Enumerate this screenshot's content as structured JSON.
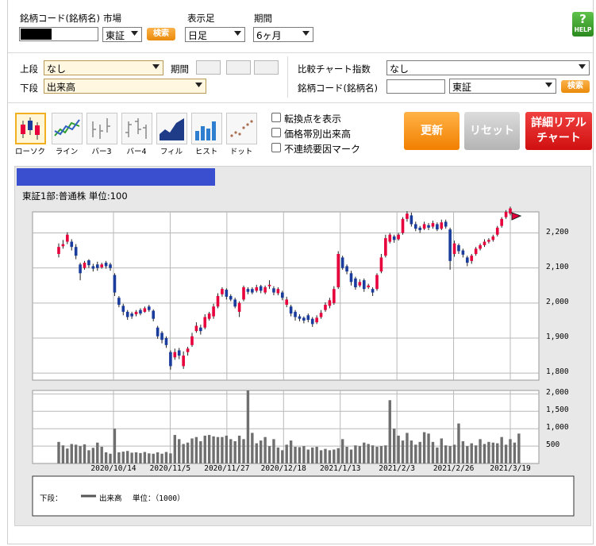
{
  "search_form": {
    "code_label": "銘柄コード(銘柄名)",
    "market_label": "市場",
    "market_value": "東証",
    "search_button": "検索",
    "foot_label": "表示足",
    "foot_value": "日足",
    "period_label": "期間",
    "period_value": "6ヶ月",
    "help_button": "HELP"
  },
  "indicators": {
    "upper_label": "上段",
    "upper_value": "なし",
    "period_label": "期間",
    "lower_label": "下段",
    "lower_value": "出来高",
    "compare_label": "比較チャート指数",
    "compare_value": "なし",
    "compare_code_label": "銘柄コード(銘柄名)",
    "compare_market_value": "東証",
    "compare_search_button": "検索"
  },
  "chart_types": [
    {
      "label": "ローソク",
      "icon": "candlestick-icon"
    },
    {
      "label": "ライン",
      "icon": "line-chart-icon"
    },
    {
      "label": "バー3",
      "icon": "bar3-icon"
    },
    {
      "label": "バー4",
      "icon": "bar4-icon"
    },
    {
      "label": "フィル",
      "icon": "fill-chart-icon"
    },
    {
      "label": "ヒスト",
      "icon": "histogram-icon"
    },
    {
      "label": "ドット",
      "icon": "dot-chart-icon"
    }
  ],
  "options": {
    "turning_point": "転換点を表示",
    "volume_by_price": "価格帯別出来高",
    "discontinuity": "不連続要因マーク"
  },
  "actions": {
    "update": "更新",
    "reset": "リセット",
    "realtime_line1": "詳細リアル",
    "realtime_line2": "チャート"
  },
  "chart_header": "東証1部:普通株 単位:100",
  "legend": {
    "prefix": "下段：",
    "series": "出来高",
    "unit": "単位：（1000）"
  },
  "colors": {
    "up": "#e8003c",
    "down": "#1a3c9c",
    "volume": "#6f6f6f",
    "update_btn": "#f7931e",
    "reset_btn": "#c8c8c8",
    "realtime_btn": "#e02020"
  },
  "chart_data": {
    "type": "candlestick",
    "price_axis": {
      "ticks": [
        "2,200",
        "2,100",
        "2,000",
        "1,900",
        "1,800"
      ],
      "ylim": [
        1780,
        2260
      ]
    },
    "volume_axis": {
      "ticks": [
        "2,000",
        "1,500",
        "1,000",
        "500"
      ],
      "ylim": [
        0,
        2100
      ]
    },
    "x_labels": [
      "2020/10/14",
      "2020/11/5",
      "2020/11/27",
      "2020/12/18",
      "2021/1/13",
      "2021/2/3",
      "2021/2/26",
      "2021/3/19"
    ],
    "candles": [
      {
        "o": 2140.0,
        "c": 2160.0,
        "h": 2170.0,
        "l": 2130.0
      },
      {
        "o": 2162.0,
        "c": 2168.0,
        "h": 2180.0,
        "l": 2155.0
      },
      {
        "o": 2175.0,
        "c": 2195.0,
        "h": 2202.0,
        "l": 2168.0
      },
      {
        "o": 2175.0,
        "c": 2160.0,
        "h": 2182.0,
        "l": 2150.0
      },
      {
        "o": 2160.0,
        "c": 2135.0,
        "h": 2168.0,
        "l": 2125.0
      },
      {
        "o": 2110.0,
        "c": 2085.0,
        "h": 2115.0,
        "l": 2065.0
      },
      {
        "o": 2100.0,
        "c": 2115.0,
        "h": 2120.0,
        "l": 2095.0
      },
      {
        "o": 2122.0,
        "c": 2108.0,
        "h": 2125.0,
        "l": 2100.0
      },
      {
        "o": 2105.0,
        "c": 2098.0,
        "h": 2112.0,
        "l": 2090.0
      },
      {
        "o": 2110.0,
        "c": 2100.0,
        "h": 2118.0,
        "l": 2092.0
      },
      {
        "o": 2102.0,
        "c": 2110.0,
        "h": 2115.0,
        "l": 2098.0
      },
      {
        "o": 2115.0,
        "c": 2105.0,
        "h": 2120.0,
        "l": 2098.0
      },
      {
        "o": 2110.0,
        "c": 2100.0,
        "h": 2115.0,
        "l": 2092.0
      },
      {
        "o": 2080.0,
        "c": 2030.0,
        "h": 2085.0,
        "l": 2020.0
      },
      {
        "o": 2015.0,
        "c": 1995.0,
        "h": 2020.0,
        "l": 1988.0
      },
      {
        "o": 1992.0,
        "c": 1975.0,
        "h": 1998.0,
        "l": 1965.0
      },
      {
        "o": 1975.0,
        "c": 1960.0,
        "h": 1980.0,
        "l": 1952.0
      },
      {
        "o": 1970.0,
        "c": 1962.0,
        "h": 1975.0,
        "l": 1955.0
      },
      {
        "o": 1968.0,
        "c": 1975.0,
        "h": 1980.0,
        "l": 1962.0
      },
      {
        "o": 1980.0,
        "c": 1970.0,
        "h": 1985.0,
        "l": 1965.0
      },
      {
        "o": 1975.0,
        "c": 1985.0,
        "h": 1990.0,
        "l": 1972.0
      },
      {
        "o": 1990.0,
        "c": 1980.0,
        "h": 1995.0,
        "l": 1975.0
      },
      {
        "o": 1978.0,
        "c": 1955.0,
        "h": 1982.0,
        "l": 1948.0
      },
      {
        "o": 1930.0,
        "c": 1905.0,
        "h": 1935.0,
        "l": 1898.0
      },
      {
        "o": 1915.0,
        "c": 1895.0,
        "h": 1920.0,
        "l": 1885.0
      },
      {
        "o": 1900.0,
        "c": 1880.0,
        "h": 1905.0,
        "l": 1872.0
      },
      {
        "o": 1860.0,
        "c": 1820.0,
        "h": 1865.0,
        "l": 1810.0
      },
      {
        "o": 1845.0,
        "c": 1860.0,
        "h": 1870.0,
        "l": 1838.0
      },
      {
        "o": 1865.0,
        "c": 1850.0,
        "h": 1872.0,
        "l": 1840.0
      },
      {
        "o": 1820.0,
        "c": 1850.0,
        "h": 1862.0,
        "l": 1812.0
      },
      {
        "o": 1860.0,
        "c": 1870.0,
        "h": 1875.0,
        "l": 1850.0
      },
      {
        "o": 1880.0,
        "c": 1905.0,
        "h": 1915.0,
        "l": 1875.0
      },
      {
        "o": 1920.0,
        "c": 1935.0,
        "h": 1945.0,
        "l": 1915.0
      },
      {
        "o": 1930.0,
        "c": 1920.0,
        "h": 1938.0,
        "l": 1910.0
      },
      {
        "o": 1930.0,
        "c": 1960.0,
        "h": 1968.0,
        "l": 1925.0
      },
      {
        "o": 1955.0,
        "c": 1970.0,
        "h": 1975.0,
        "l": 1950.0
      },
      {
        "o": 1962.0,
        "c": 1990.0,
        "h": 1998.0,
        "l": 1955.0
      },
      {
        "o": 1990.0,
        "c": 2020.0,
        "h": 2028.0,
        "l": 1985.0
      },
      {
        "o": 2025.0,
        "c": 2040.0,
        "h": 2045.0,
        "l": 2018.0
      },
      {
        "o": 2038.0,
        "c": 2018.0,
        "h": 2042.0,
        "l": 2010.0
      },
      {
        "o": 2020.0,
        "c": 2010.0,
        "h": 2025.0,
        "l": 2005.0
      },
      {
        "o": 2010.0,
        "c": 1990.0,
        "h": 2015.0,
        "l": 1985.0
      },
      {
        "o": 1975.0,
        "c": 2000.0,
        "h": 2005.0,
        "l": 1960.0
      },
      {
        "o": 2010.0,
        "c": 2045.0,
        "h": 2050.0,
        "l": 2005.0
      },
      {
        "o": 2040.0,
        "c": 2032.0,
        "h": 2045.0,
        "l": 2025.0
      },
      {
        "o": 2040.0,
        "c": 2030.0,
        "h": 2045.0,
        "l": 2025.0
      },
      {
        "o": 2035.0,
        "c": 2045.0,
        "h": 2052.0,
        "l": 2030.0
      },
      {
        "o": 2048.0,
        "c": 2035.0,
        "h": 2052.0,
        "l": 2028.0
      },
      {
        "o": 2030.0,
        "c": 2045.0,
        "h": 2050.0,
        "l": 2025.0
      },
      {
        "o": 2048.0,
        "c": 2052.0,
        "h": 2065.0,
        "l": 2040.0
      },
      {
        "o": 2042.0,
        "c": 2030.0,
        "h": 2048.0,
        "l": 2022.0
      },
      {
        "o": 2028.0,
        "c": 2040.0,
        "h": 2045.0,
        "l": 2022.0
      },
      {
        "o": 2030.0,
        "c": 2015.0,
        "h": 2035.0,
        "l": 2008.0
      },
      {
        "o": 1995.0,
        "c": 2010.0,
        "h": 2018.0,
        "l": 1988.0
      },
      {
        "o": 1990.0,
        "c": 1970.0,
        "h": 1995.0,
        "l": 1962.0
      },
      {
        "o": 1975.0,
        "c": 1960.0,
        "h": 1980.0,
        "l": 1950.0
      },
      {
        "o": 1962.0,
        "c": 1955.0,
        "h": 1968.0,
        "l": 1948.0
      },
      {
        "o": 1958.0,
        "c": 1950.0,
        "h": 1962.0,
        "l": 1942.0
      },
      {
        "o": 1965.0,
        "c": 1952.0,
        "h": 1970.0,
        "l": 1945.0
      },
      {
        "o": 1955.0,
        "c": 1940.0,
        "h": 1960.0,
        "l": 1932.0
      },
      {
        "o": 1945.0,
        "c": 1958.0,
        "h": 1965.0,
        "l": 1940.0
      },
      {
        "o": 1960.0,
        "c": 1972.0,
        "h": 1980.0,
        "l": 1955.0
      },
      {
        "o": 1980.0,
        "c": 1995.0,
        "h": 2002.0,
        "l": 1975.0
      },
      {
        "o": 1992.0,
        "c": 2008.0,
        "h": 2015.0,
        "l": 1985.0
      },
      {
        "o": 2000.0,
        "c": 2040.0,
        "h": 2048.0,
        "l": 1995.0
      },
      {
        "o": 2045.0,
        "c": 2140.0,
        "h": 2148.0,
        "l": 2040.0
      },
      {
        "o": 2130.0,
        "c": 2100.0,
        "h": 2135.0,
        "l": 2095.0
      },
      {
        "o": 2105.0,
        "c": 2090.0,
        "h": 2110.0,
        "l": 2082.0
      },
      {
        "o": 2085.0,
        "c": 2060.0,
        "h": 2092.0,
        "l": 2050.0
      },
      {
        "o": 2070.0,
        "c": 2045.0,
        "h": 2075.0,
        "l": 2038.0
      },
      {
        "o": 2050.0,
        "c": 2060.0,
        "h": 2068.0,
        "l": 2045.0
      },
      {
        "o": 2065.0,
        "c": 2040.0,
        "h": 2070.0,
        "l": 2032.0
      },
      {
        "o": 2045.0,
        "c": 2050.0,
        "h": 2055.0,
        "l": 2040.0
      },
      {
        "o": 2040.0,
        "c": 2030.0,
        "h": 2045.0,
        "l": 2020.0
      },
      {
        "o": 2040.0,
        "c": 2080.0,
        "h": 2085.0,
        "l": 2035.0
      },
      {
        "o": 2090.0,
        "c": 2130.0,
        "h": 2140.0,
        "l": 2085.0
      },
      {
        "o": 2135.0,
        "c": 2185.0,
        "h": 2195.0,
        "l": 2130.0
      },
      {
        "o": 2175.0,
        "c": 2195.0,
        "h": 2200.0,
        "l": 2170.0
      },
      {
        "o": 2190.0,
        "c": 2180.0,
        "h": 2195.0,
        "l": 2172.0
      },
      {
        "o": 2182.0,
        "c": 2195.0,
        "h": 2200.0,
        "l": 2178.0
      },
      {
        "o": 2200.0,
        "c": 2240.0,
        "h": 2245.0,
        "l": 2195.0
      },
      {
        "o": 2240.0,
        "c": 2255.0,
        "h": 2262.0,
        "l": 2232.0
      },
      {
        "o": 2250.0,
        "c": 2225.0,
        "h": 2258.0,
        "l": 2218.0
      },
      {
        "o": 2225.0,
        "c": 2212.0,
        "h": 2232.0,
        "l": 2205.0
      },
      {
        "o": 2215.0,
        "c": 2208.0,
        "h": 2220.0,
        "l": 2200.0
      },
      {
        "o": 2212.0,
        "c": 2225.0,
        "h": 2232.0,
        "l": 2208.0
      },
      {
        "o": 2222.0,
        "c": 2215.0,
        "h": 2228.0,
        "l": 2208.0
      },
      {
        "o": 2218.0,
        "c": 2228.0,
        "h": 2235.0,
        "l": 2212.0
      },
      {
        "o": 2225.0,
        "c": 2210.0,
        "h": 2230.0,
        "l": 2205.0
      },
      {
        "o": 2212.0,
        "c": 2230.0,
        "h": 2238.0,
        "l": 2208.0
      },
      {
        "o": 2232.0,
        "c": 2218.0,
        "h": 2238.0,
        "l": 2212.0
      },
      {
        "o": 2210.0,
        "c": 2120.0,
        "h": 2215.0,
        "l": 2095.0
      },
      {
        "o": 2140.0,
        "c": 2170.0,
        "h": 2178.0,
        "l": 2132.0
      },
      {
        "o": 2165.0,
        "c": 2148.0,
        "h": 2170.0,
        "l": 2140.0
      },
      {
        "o": 2150.0,
        "c": 2138.0,
        "h": 2155.0,
        "l": 2130.0
      },
      {
        "o": 2130.0,
        "c": 2115.0,
        "h": 2135.0,
        "l": 2105.0
      },
      {
        "o": 2120.0,
        "c": 2135.0,
        "h": 2140.0,
        "l": 2112.0
      },
      {
        "o": 2140.0,
        "c": 2155.0,
        "h": 2160.0,
        "l": 2135.0
      },
      {
        "o": 2155.0,
        "c": 2165.0,
        "h": 2170.0,
        "l": 2150.0
      },
      {
        "o": 2165.0,
        "c": 2175.0,
        "h": 2182.0,
        "l": 2160.0
      },
      {
        "o": 2175.0,
        "c": 2180.0,
        "h": 2185.0,
        "l": 2170.0
      },
      {
        "o": 2180.0,
        "c": 2190.0,
        "h": 2195.0,
        "l": 2175.0
      },
      {
        "o": 2195.0,
        "c": 2215.0,
        "h": 2220.0,
        "l": 2190.0
      },
      {
        "o": 2220.0,
        "c": 2240.0,
        "h": 2245.0,
        "l": 2215.0
      },
      {
        "o": 2245.0,
        "c": 2260.0,
        "h": 2265.0,
        "l": 2240.0
      },
      {
        "o": 2255.0,
        "c": 2270.0,
        "h": 2275.0,
        "l": 2250.0
      }
    ],
    "volumes": [
      620,
      520,
      430,
      560,
      540,
      500,
      550,
      380,
      450,
      600,
      480,
      320,
      280,
      1000,
      320,
      340,
      360,
      310,
      320,
      300,
      330,
      290,
      280,
      320,
      280,
      330,
      290,
      820,
      700,
      560,
      600,
      720,
      760,
      640,
      800,
      820,
      780,
      760,
      760,
      800,
      700,
      640,
      800,
      700,
      2100,
      880,
      580,
      660,
      760,
      500,
      700,
      460,
      380,
      540,
      660,
      480,
      470,
      500,
      400,
      460,
      480,
      380,
      420,
      380,
      400,
      440,
      700,
      480,
      400,
      520,
      500,
      600,
      560,
      520,
      480,
      500,
      520,
      1820,
      1000,
      800,
      660,
      880,
      660,
      540,
      620,
      900,
      860,
      620,
      460,
      720,
      520,
      500,
      540,
      1150,
      640,
      500,
      580,
      520,
      700,
      560,
      620,
      600,
      580,
      760,
      540,
      700,
      600,
      860
    ]
  }
}
